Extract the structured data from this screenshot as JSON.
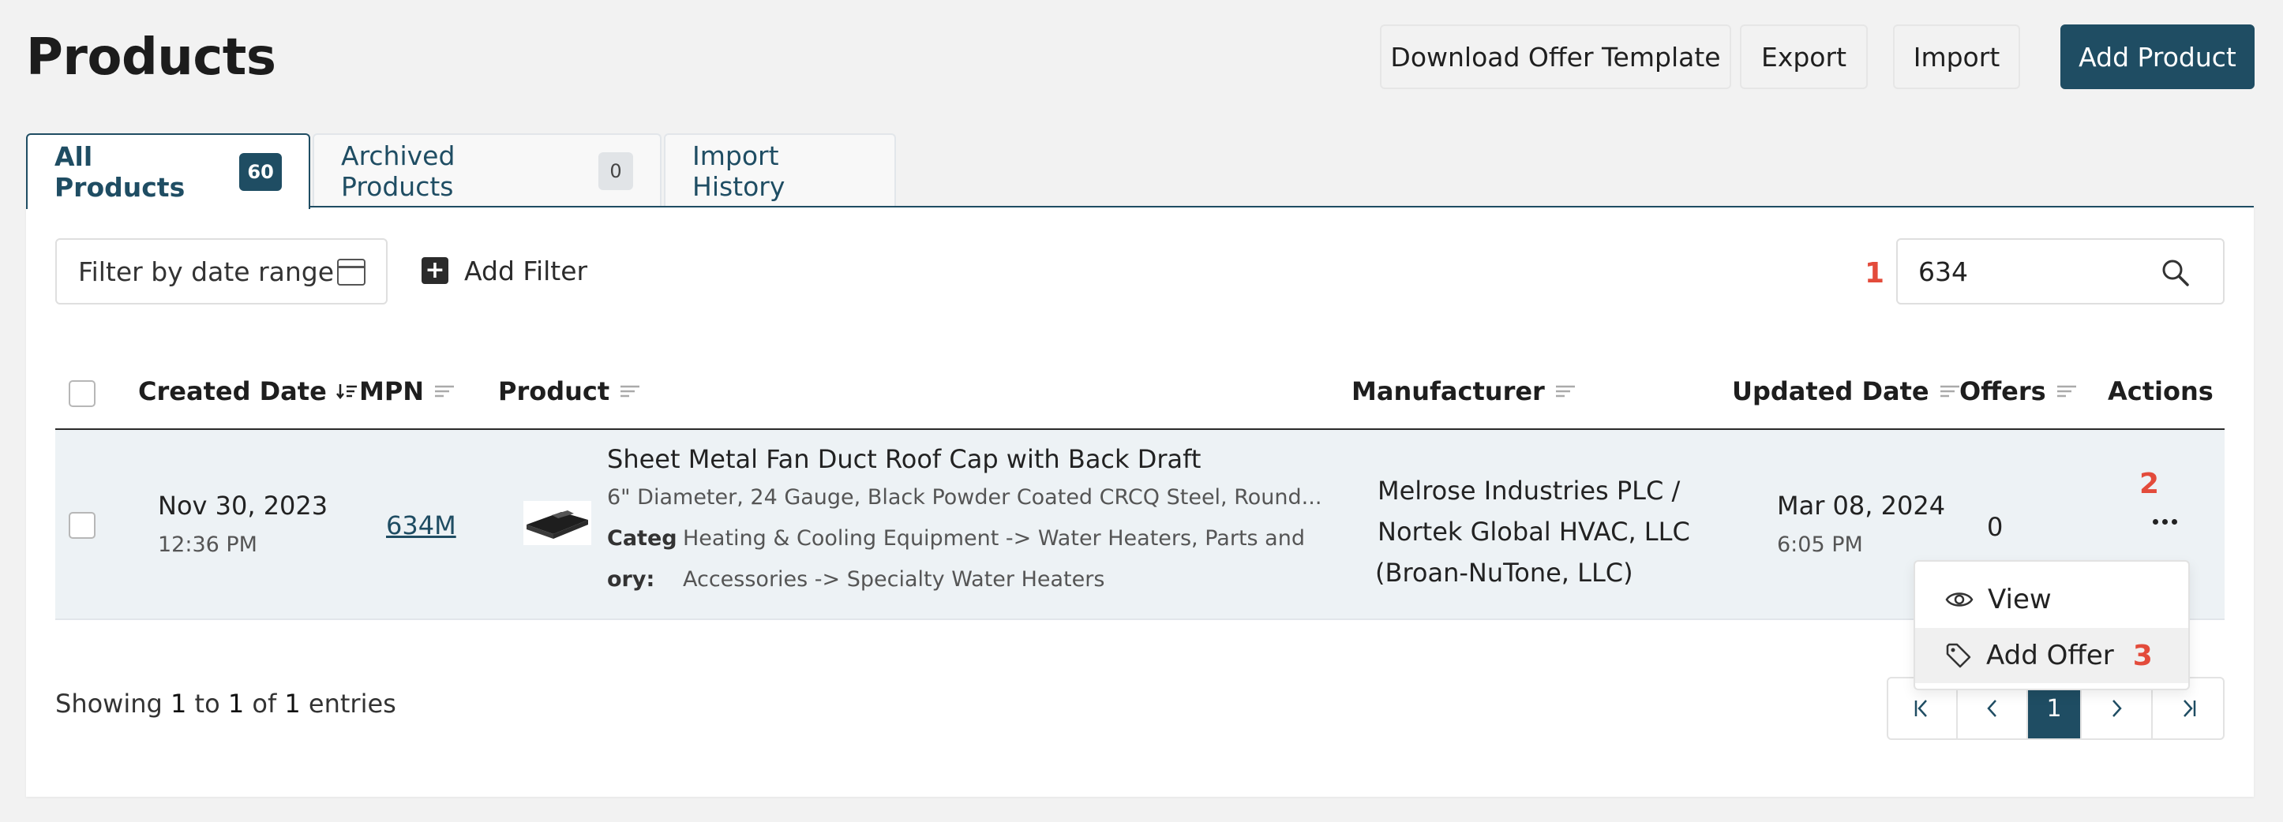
{
  "header": {
    "title": "Products",
    "buttons": {
      "download_template": "Download Offer Template",
      "export": "Export",
      "import": "Import",
      "add_product": "Add Product"
    }
  },
  "tabs": [
    {
      "label": "All Products",
      "count": "60"
    },
    {
      "label": "Archived Products",
      "count": "0"
    },
    {
      "label": "Import History"
    }
  ],
  "filters": {
    "date_range_label": "Filter by date range",
    "add_filter_label": "Add Filter",
    "search_value": "634"
  },
  "annotations": {
    "one": "1",
    "two": "2",
    "three": "3"
  },
  "table": {
    "headers": {
      "created_date": "Created Date",
      "mpn": "MPN",
      "product": "Product",
      "manufacturer": "Manufacturer",
      "updated_date": "Updated Date",
      "offers": "Offers",
      "actions": "Actions"
    },
    "rows": [
      {
        "created_date": "Nov 30, 2023",
        "created_time": "12:36 PM",
        "mpn": "634M",
        "product_name": "Sheet Metal Fan Duct Roof Cap with Back Draft",
        "product_desc": "6\" Diameter, 24 Gauge, Black Powder Coated CRCQ Steel, Round...",
        "category_label_1": "Categ",
        "category_label_2": "ory:",
        "category_line_1": "Heating & Cooling Equipment -> Water Heaters, Parts and",
        "category_line_2": "Accessories -> Specialty Water Heaters",
        "manufacturer_line_1": "Melrose Industries PLC /",
        "manufacturer_line_2": "Nortek Global HVAC, LLC",
        "manufacturer_line_3": "(Broan-NuTone, LLC)",
        "updated_date": "Mar 08, 2024",
        "updated_time": "6:05 PM",
        "offers": "0"
      }
    ]
  },
  "footer": {
    "showing_prefix": "Showing",
    "from": "1",
    "to_word": "to",
    "to": "1",
    "of_word": "of",
    "total": "1",
    "suffix": "entries"
  },
  "pagination": {
    "current": "1"
  },
  "action_menu": {
    "view": "View",
    "add_offer": "Add Offer"
  },
  "colors": {
    "brand": "#1f4d63",
    "annotation": "#e34b3b",
    "row_highlight": "#edf2f5"
  }
}
